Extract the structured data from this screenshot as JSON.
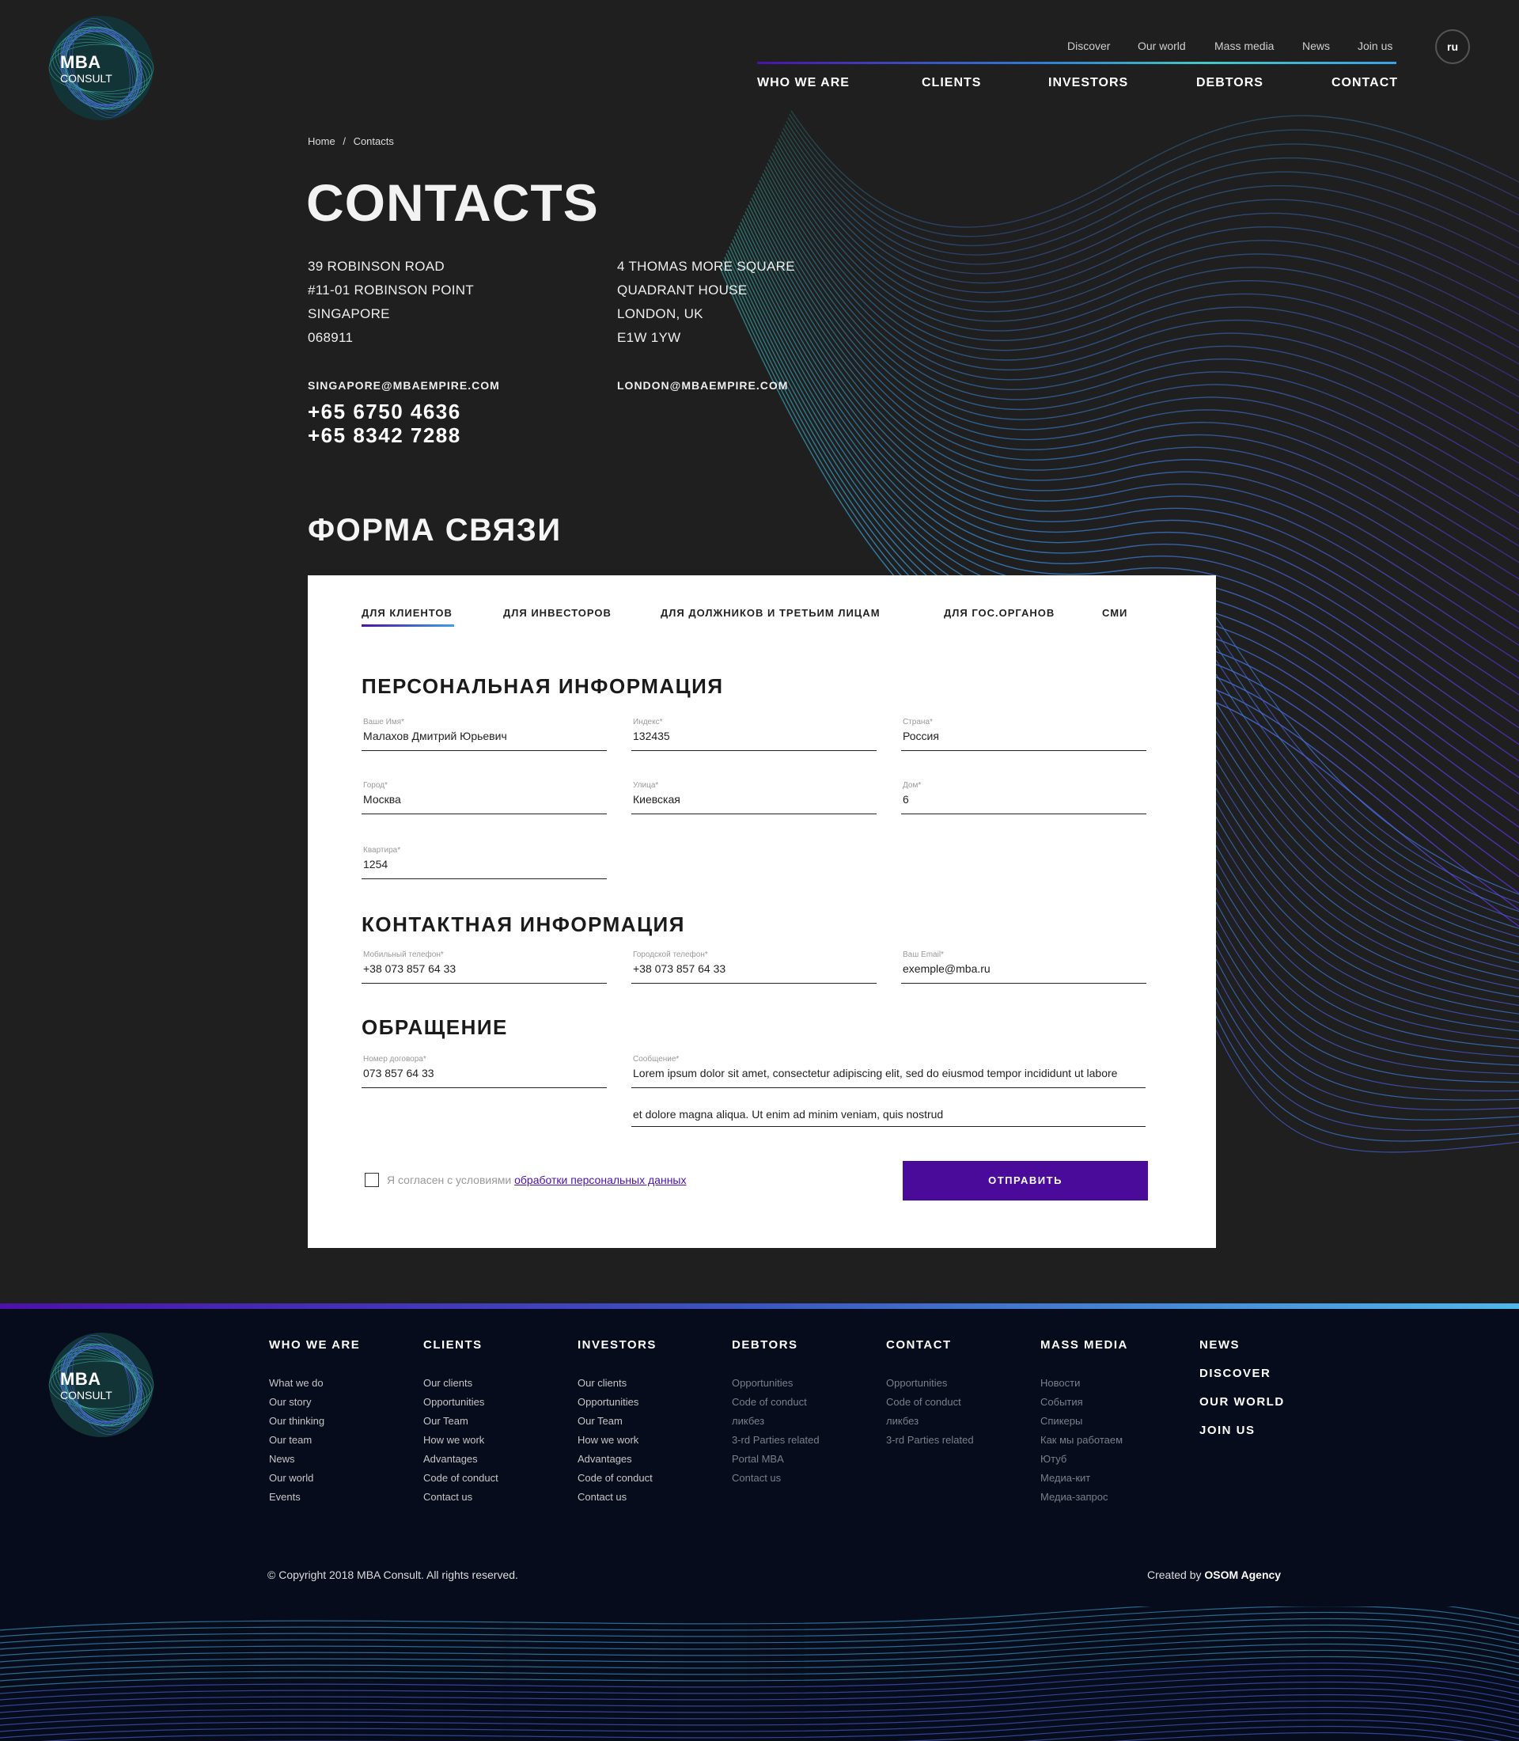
{
  "header": {
    "logo": {
      "line1": "MBA",
      "line2": "CONSULT"
    },
    "top_links": [
      "Discover",
      "Our world",
      "Mass media",
      "News",
      "Join us"
    ],
    "lang": "ru",
    "main_nav": [
      "WHO WE ARE",
      "CLIENTS",
      "INVESTORS",
      "DEBTORS",
      "CONTACT"
    ]
  },
  "breadcrumb": {
    "home": "Home",
    "sep": "/",
    "current": "Contacts"
  },
  "page_title": "CONTACTS",
  "offices": [
    {
      "lines": [
        "39 ROBINSON ROAD",
        "#11-01 ROBINSON POINT",
        "SINGAPORE",
        "068911"
      ],
      "email": "SINGAPORE@MBAEMPIRE.COM",
      "phones": [
        "+65 6750 4636",
        "+65 8342 7288"
      ]
    },
    {
      "lines": [
        "4 THOMAS MORE SQUARE",
        "QUADRANT HOUSE",
        "LONDON, UK",
        "E1W 1YW"
      ],
      "email": "LONDON@MBAEMPIRE.COM"
    }
  ],
  "form": {
    "title": "ФОРМА СВЯЗИ",
    "tabs": [
      "ДЛЯ КЛИЕНТОВ",
      "ДЛЯ ИНВЕСТОРОВ",
      "ДЛЯ ДОЛЖНИКОВ И ТРЕТЬИМ ЛИЦАМ",
      "ДЛЯ ГОС.ОРГАНОВ",
      "СМИ"
    ],
    "active_tab": 0,
    "personal": {
      "title": "ПЕРСОНАЛЬНАЯ ИНФОРМАЦИЯ",
      "fields": [
        {
          "label": "Ваше Имя*",
          "value": "Малахов Дмитрий Юрьевич"
        },
        {
          "label": "Индекс*",
          "value": "132435"
        },
        {
          "label": "Страна*",
          "value": "Россия"
        },
        {
          "label": "Город*",
          "value": "Москва"
        },
        {
          "label": "Улица*",
          "value": "Киевская"
        },
        {
          "label": "Дом*",
          "value": "6"
        },
        {
          "label": "Квартира*",
          "value": "1254"
        }
      ]
    },
    "contact": {
      "title": "КОНТАКТНАЯ ИНФОРМАЦИЯ",
      "fields": [
        {
          "label": "Мобильный телефон*",
          "value": "+38 073 857 64 33"
        },
        {
          "label": "Городской телефон*",
          "value": "+38 073 857 64 33"
        },
        {
          "label": "Ваш Email*",
          "value": "exemple@mba.ru"
        }
      ]
    },
    "appeal": {
      "title": "ОБРАЩЕНИЕ",
      "contract": {
        "label": "Номер договора*",
        "value": "073 857 64 33"
      },
      "message": {
        "label": "Сообщение*",
        "line1": "Lorem ipsum dolor sit amet, consectetur adipiscing elit, sed do eiusmod tempor incididunt ut labore",
        "line2": "et dolore magna aliqua. Ut enim ad minim veniam, quis nostrud"
      }
    },
    "agree_text": "Я согласен с условиями",
    "agree_link": "обработки персональных данных",
    "submit": "ОТПРАВИТЬ"
  },
  "footer": {
    "columns": [
      {
        "title": "WHO WE ARE",
        "links": [
          "What we do",
          "Our story",
          "Our thinking",
          "Our team",
          "News",
          "Our world",
          "Events"
        ]
      },
      {
        "title": "CLIENTS",
        "links": [
          "Our clients",
          "Opportunities",
          "Our Team",
          "How we work",
          "Advantages",
          "Code of conduct",
          "Contact us"
        ]
      },
      {
        "title": "INVESTORS",
        "links": [
          "Our clients",
          "Opportunities",
          "Our Team",
          "How we work",
          "Advantages",
          "Code of conduct",
          "Contact us"
        ]
      },
      {
        "title": "DEBTORS",
        "links": [
          "Opportunities",
          "Code of conduct",
          "ликбез",
          "3-rd Parties related",
          "Portal MBA",
          "Contact us"
        ]
      },
      {
        "title": "CONTACT",
        "links": [
          "Opportunities",
          "Code of conduct",
          "ликбез",
          "3-rd Parties related"
        ]
      },
      {
        "title": "MASS MEDIA",
        "links": [
          "Новости",
          "События",
          "Спикеры",
          "Как мы работаем",
          "Ютуб",
          "Медиа-кит",
          "Медиа-запрос"
        ]
      }
    ],
    "big_links": [
      "NEWS",
      "DISCOVER",
      "OUR WORLD",
      "JOIN US"
    ],
    "copyright": "© Copyright 2018 MBA Consult. All rights reserved.",
    "created_prefix": "Created by",
    "created_by": "OSOM Agency"
  },
  "colors": {
    "background": "#1f1f1f",
    "footer": "#070c1c",
    "accent": "#4a0a9a",
    "wave_teal": "#3fa7a0",
    "wave_blue": "#3b8fe0"
  }
}
